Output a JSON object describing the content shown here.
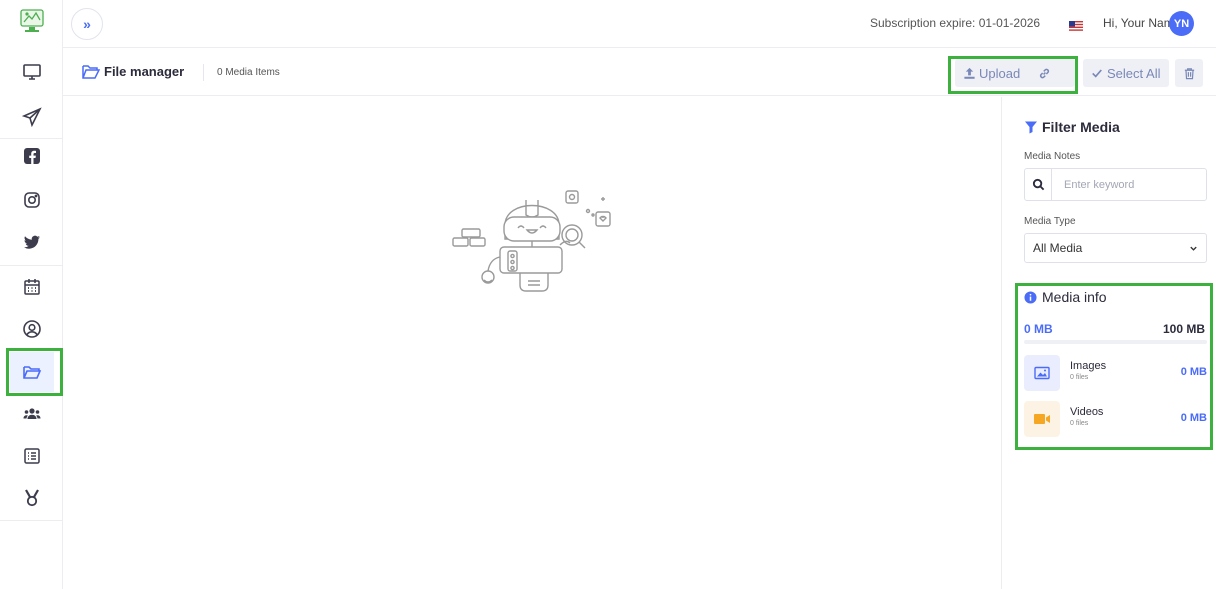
{
  "topbar": {
    "expand_label": "»",
    "subscription": "Subscription expire: 01-01-2026",
    "greeting": "Hi, Your Name",
    "avatar_initials": "YN"
  },
  "header": {
    "title": "File manager",
    "count": "0 Media Items",
    "upload_label": "Upload",
    "select_all_label": "Select All"
  },
  "filter": {
    "title": "Filter Media",
    "notes_label": "Media Notes",
    "search_placeholder": "Enter keyword",
    "type_label": "Media Type",
    "type_selected": "All Media"
  },
  "media_info": {
    "title": "Media info",
    "used": "0 MB",
    "total": "100 MB",
    "usage_fraction": 0,
    "items": [
      {
        "name": "Images",
        "files": "0 files",
        "size": "0 MB",
        "icon": "image-icon"
      },
      {
        "name": "Videos",
        "files": "0 files",
        "size": "0 MB",
        "icon": "video-icon"
      }
    ]
  },
  "sidebar": {
    "items": [
      "monitor-icon",
      "send-icon",
      "facebook-icon",
      "instagram-icon",
      "twitter-icon",
      "calendar-icon",
      "user-circle-icon",
      "folder-icon",
      "users-icon",
      "list-icon",
      "medal-icon"
    ]
  },
  "colors": {
    "accent": "#4a6cf7",
    "highlight": "#3db13d"
  }
}
